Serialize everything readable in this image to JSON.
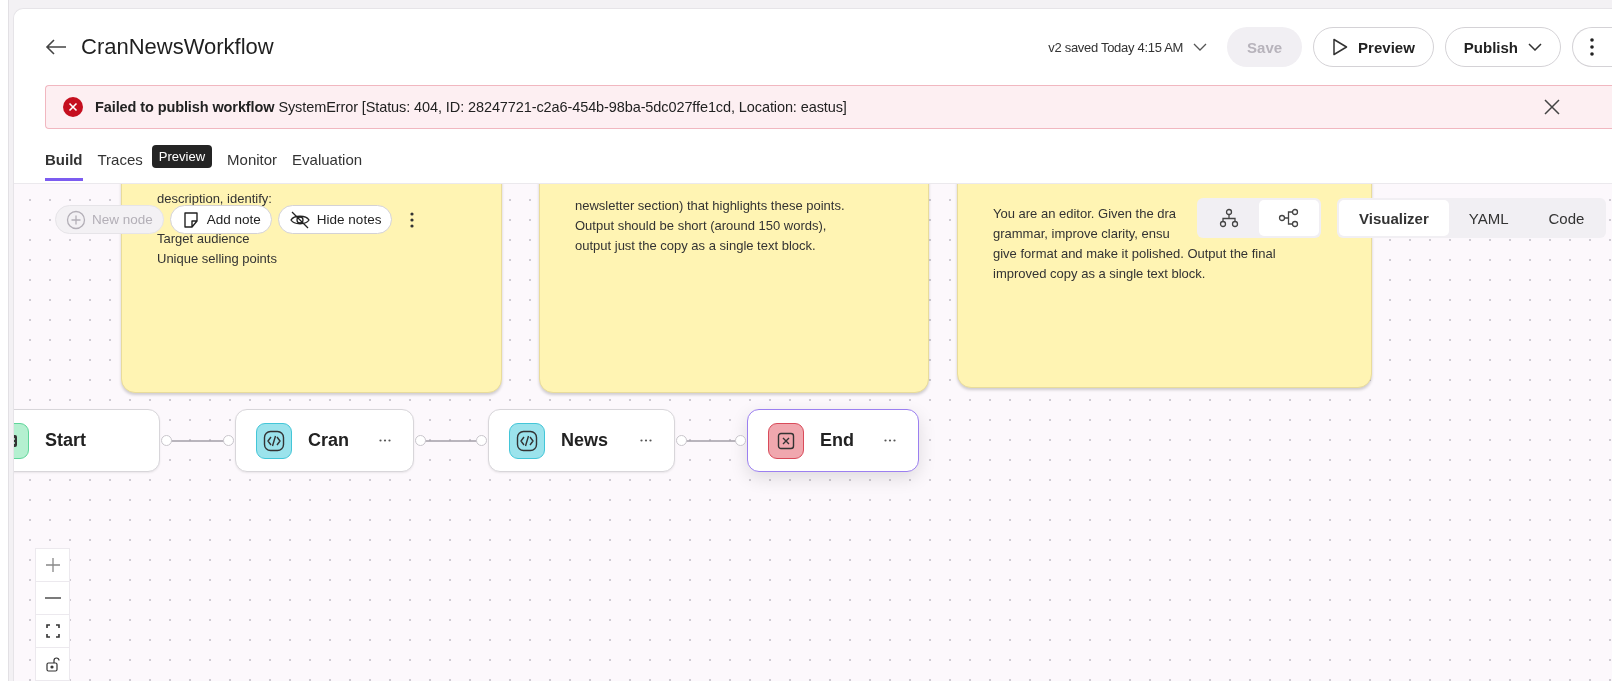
{
  "header": {
    "title": "CranNewsWorkflow",
    "version_status": "v2 saved Today 4:15 AM",
    "save": {
      "label": "Save",
      "disabled": true
    },
    "preview": {
      "label": "Preview"
    },
    "publish": {
      "label": "Publish"
    }
  },
  "error_banner": {
    "title": "Failed to publish workflow",
    "message": "SystemError [Status: 404, ID: 28247721-c2a6-454b-98ba-5dc027ffe1cd, Location: eastus]"
  },
  "tabs": [
    {
      "label": "Build",
      "selected": true
    },
    {
      "label": "Traces",
      "selected": false,
      "badge": "Preview"
    },
    {
      "label": "Monitor",
      "selected": false
    },
    {
      "label": "Evaluation",
      "selected": false
    }
  ],
  "canvas_toolbar": [
    {
      "label": "New node",
      "kind": "add",
      "disabled": true
    },
    {
      "label": "Add note",
      "kind": "note",
      "disabled": false
    },
    {
      "label": "Hide notes",
      "kind": "hide",
      "disabled": false
    }
  ],
  "layout_toggle": [
    {
      "kind": "vertical",
      "selected": false
    },
    {
      "kind": "horizontal",
      "selected": true
    }
  ],
  "view_tabs": [
    {
      "label": "Visualizer",
      "selected": true
    },
    {
      "label": "YAML",
      "selected": false
    },
    {
      "label": "Code",
      "selected": false
    }
  ],
  "notes": [
    {
      "lines": [
        "description, identify:",
        "Target audience",
        "Unique selling points"
      ]
    },
    {
      "lines": [
        "newsletter section) that highlights these points.",
        "Output should be short (around 150 words),",
        "output just the copy as a single text block."
      ]
    },
    {
      "lines": [
        "You are an editor. Given the dra",
        "grammar, improve clarity, ensu",
        "give format and make it polished. Output the final",
        "improved copy as a single text block."
      ]
    }
  ],
  "nodes": [
    {
      "label": "Start",
      "kind": "start",
      "selected": false
    },
    {
      "label": "Cran",
      "kind": "code",
      "selected": false
    },
    {
      "label": "News",
      "kind": "code",
      "selected": false
    },
    {
      "label": "End",
      "kind": "end",
      "selected": true
    }
  ]
}
